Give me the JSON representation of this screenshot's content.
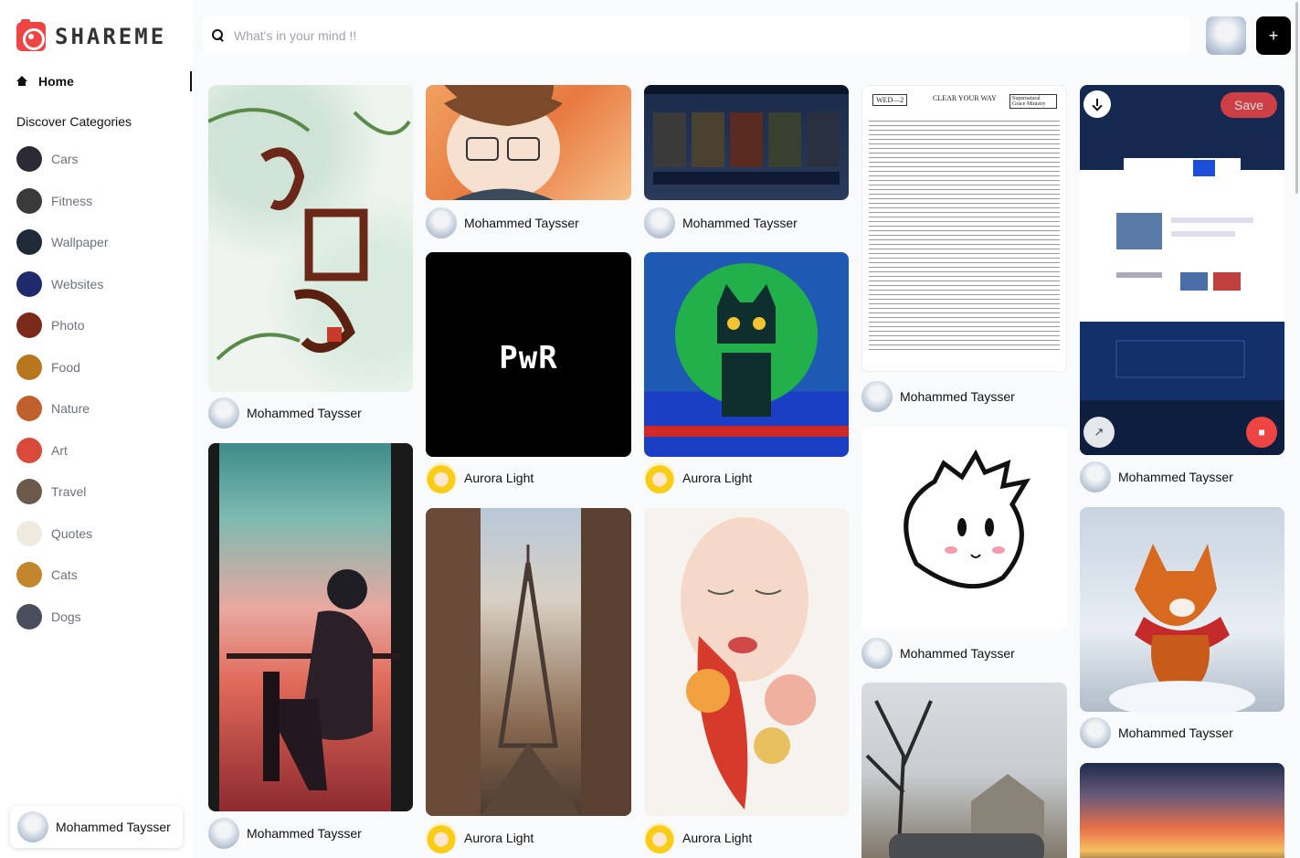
{
  "app": {
    "logo_text": "SHAREME"
  },
  "sidebar": {
    "home_label": "Home",
    "categories_heading": "Discover Categories",
    "categories": [
      {
        "label": "Cars",
        "color": "#2b2b35"
      },
      {
        "label": "Fitness",
        "color": "#3a3a3a"
      },
      {
        "label": "Wallpaper",
        "color": "#1f2a38"
      },
      {
        "label": "Websites",
        "color": "#1e2a6b"
      },
      {
        "label": "Photo",
        "color": "#7a2a1a"
      },
      {
        "label": "Food",
        "color": "#b8761f"
      },
      {
        "label": "Nature",
        "color": "#c0602d"
      },
      {
        "label": "Art",
        "color": "#d94a3a"
      },
      {
        "label": "Travel",
        "color": "#6b5a4a"
      },
      {
        "label": "Quotes",
        "color": "#eeeae0"
      },
      {
        "label": "Cats",
        "color": "#c4862c"
      },
      {
        "label": "Dogs",
        "color": "#4a4e5c"
      }
    ],
    "user_name": "Mohammed Taysser"
  },
  "search": {
    "placeholder": "What's in your mind !!",
    "value": ""
  },
  "header": {
    "add_label": "+"
  },
  "pins": [
    {
      "author": "Mohammed Taysser",
      "image": "qingming-calligraphy"
    },
    {
      "author": "Mohammed Taysser",
      "image": "anime-boy-window"
    },
    {
      "author": "Mohammed Taysser",
      "image": "anime-glasses"
    },
    {
      "author": "Aurora Light",
      "image": "pwr-logo",
      "text": "PwR"
    },
    {
      "author": "Aurora Light",
      "image": "eiffel-street"
    },
    {
      "author": "Mohammed Taysser",
      "image": "game-characters"
    },
    {
      "author": "Aurora Light",
      "image": "pixel-cat"
    },
    {
      "author": "Aurora Light",
      "image": "watercolor-face"
    },
    {
      "author": "Mohammed Taysser",
      "image": "bible-document",
      "doc_left": "WED—2",
      "doc_mid": "CLEAR YOUR WAY",
      "doc_right": "Supernatural Grace Ministry"
    },
    {
      "author": "Mohammed Taysser",
      "image": "cartoon-face"
    },
    {
      "author": "",
      "image": "tree-house-car"
    },
    {
      "author": "Mohammed Taysser",
      "image": "website-mockup",
      "save_label": "Save"
    },
    {
      "author": "Mohammed Taysser",
      "image": "red-fox"
    },
    {
      "author": "",
      "image": "sunset-sky"
    }
  ]
}
